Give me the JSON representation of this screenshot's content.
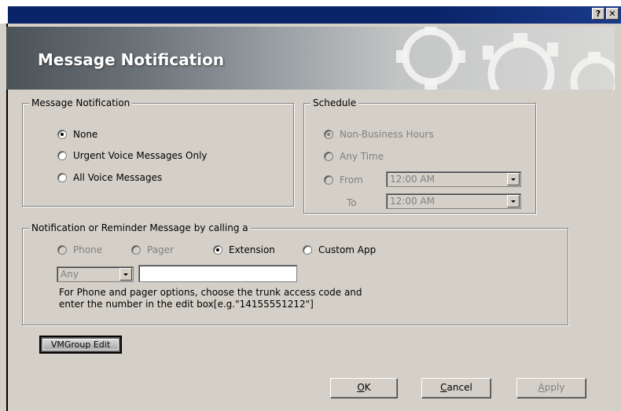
{
  "titlebar": {
    "help_glyph": "?",
    "close_glyph": "✕"
  },
  "banner": {
    "title": "Message Notification"
  },
  "message_notification": {
    "legend": "Message Notification",
    "options": [
      {
        "label": "None",
        "checked": true
      },
      {
        "label": "Urgent Voice Messages Only",
        "checked": false
      },
      {
        "label": "All Voice Messages",
        "checked": false
      }
    ]
  },
  "schedule": {
    "legend": "Schedule",
    "non_business_label": "Non-Business Hours",
    "any_time_label": "Any Time",
    "from_label": "From",
    "to_label": "To",
    "from_value": "12:00 AM",
    "to_value": "12:00 AM"
  },
  "calling": {
    "legend": "Notification or Reminder Message  by calling a",
    "phone_label": "Phone",
    "pager_label": "Pager",
    "extension_label": "Extension",
    "custom_app_label": "Custom App",
    "trunk_value": "Any",
    "number_value": "",
    "help_line1": "For Phone and pager options, choose the trunk access code and",
    "help_line2": "enter the number in the edit box[e.g.\"14155551212\"]"
  },
  "buttons": {
    "vmgroup_edit": "VMGroup Edit",
    "ok_accel": "O",
    "ok_rest": "K",
    "cancel_accel": "C",
    "cancel_rest": "ancel",
    "apply_accel": "A",
    "apply_rest": "pply"
  }
}
